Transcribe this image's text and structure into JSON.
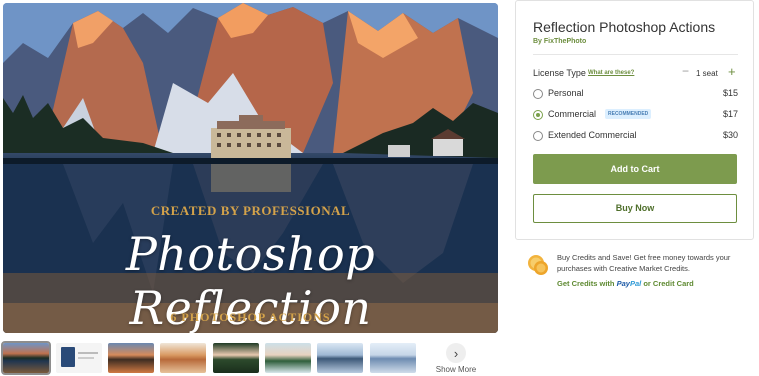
{
  "hero": {
    "subtitle": "CREATED BY PROFESSIONAL",
    "title": "Photoshop Reflection",
    "footer": "6 PHOTOSHOP  ACTIONS"
  },
  "thumbnails": [
    {
      "name": "thumb-1",
      "active": true
    },
    {
      "name": "thumb-2",
      "active": false
    },
    {
      "name": "thumb-3",
      "active": false
    },
    {
      "name": "thumb-4",
      "active": false
    },
    {
      "name": "thumb-5",
      "active": false
    },
    {
      "name": "thumb-6",
      "active": false
    },
    {
      "name": "thumb-7",
      "active": false
    },
    {
      "name": "thumb-8",
      "active": false
    }
  ],
  "show_more": {
    "label": "Show More",
    "icon": "chevron-right-icon"
  },
  "product": {
    "title": "Reflection Photoshop Actions",
    "by": "By FixThePhoto",
    "license_label": "License Type",
    "license_link": "What are these?",
    "seat_minus": "−",
    "seat_text": "1 seat",
    "seat_plus": "+",
    "options": [
      {
        "label": "Personal",
        "price": "$15",
        "selected": false
      },
      {
        "label": "Commercial",
        "price": "$17",
        "selected": true,
        "badge": "RECOMMENDED"
      },
      {
        "label": "Extended Commercial",
        "price": "$30",
        "selected": false
      }
    ],
    "add_to_cart": "Add to Cart",
    "buy_now": "Buy Now"
  },
  "credits": {
    "text": "Buy Credits and Save! Get free money towards your purchases with Creative Market Credits.",
    "link_prefix": "Get Credits with",
    "paypal_pay": "Pay",
    "paypal_pal": "Pal",
    "link_suffix": "or Credit Card",
    "icon": "coins-icon"
  },
  "colors": {
    "accent_green": "#7d9b4e",
    "link_green": "#6d8e3f",
    "badge_bg": "#dcefff",
    "hero_gold": "#d3a24a"
  }
}
